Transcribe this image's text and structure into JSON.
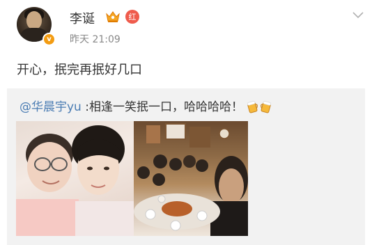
{
  "post": {
    "username": "李诞",
    "hongv_label": "红",
    "verified_mark": "v",
    "timestamp": "昨天 21:09",
    "text": "开心，抿完再抿好几口"
  },
  "repost": {
    "mention": "@华晨宇yu",
    "text": " :相逢一笑抿一口，哈哈哈哈！",
    "emoji": "cheers-emoji"
  },
  "photos": [
    {
      "name": "selfie-photo"
    },
    {
      "name": "dinner-group-photo"
    }
  ],
  "colors": {
    "mention_link": "#4a7cb3",
    "verified_orange": "#f39c12",
    "hongv_red": "#ef5b4c",
    "repost_bg": "#f2f2f2"
  },
  "icons": [
    "chevron-down-icon",
    "vip-crown-icon",
    "verified-icon",
    "cheers-emoji"
  ]
}
